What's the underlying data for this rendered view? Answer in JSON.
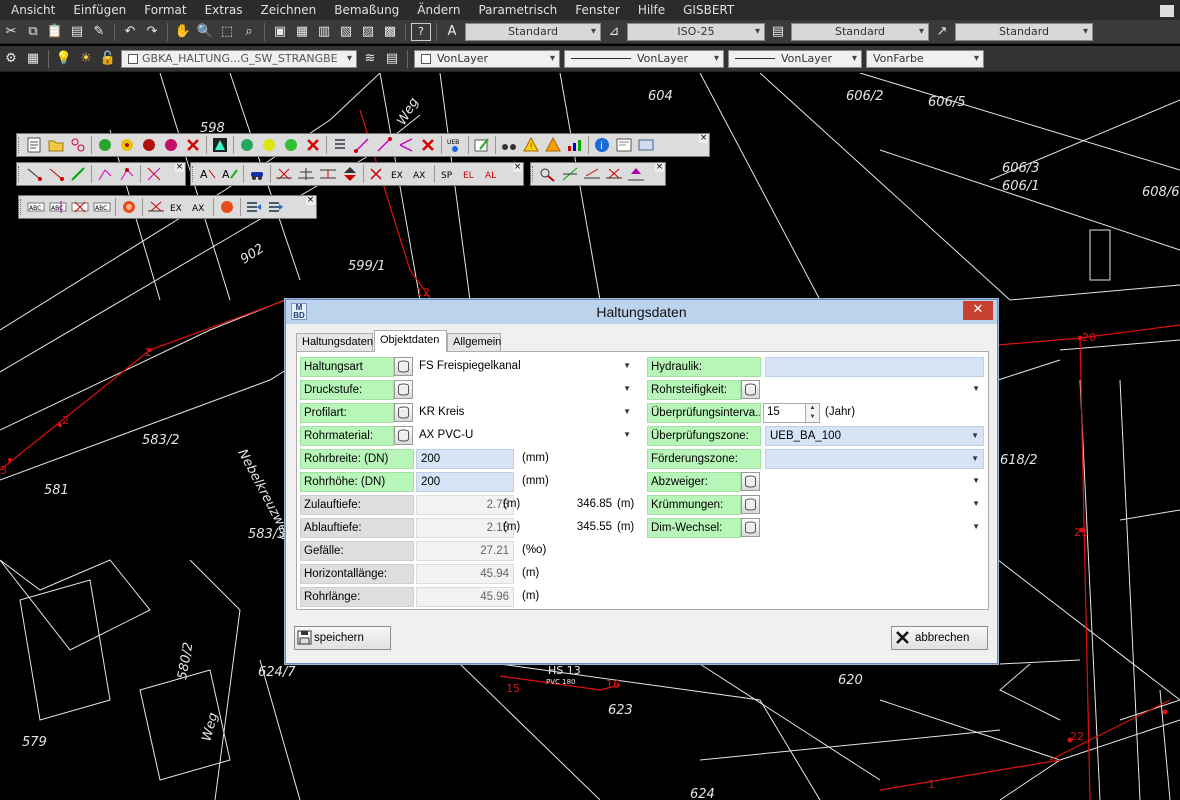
{
  "menu": [
    "Ansicht",
    "Einfügen",
    "Format",
    "Extras",
    "Zeichnen",
    "Bemaßung",
    "Ändern",
    "Parametrisch",
    "Fenster",
    "Hilfe",
    "GISBERT"
  ],
  "toolbar": {
    "text_style": "Standard",
    "dim_style": "ISO-25",
    "table_style": "Standard",
    "multileader_style": "Standard",
    "layer": "GBKA_HALTUNG...G_SW_STRANGBE",
    "color": "VonLayer",
    "linetype": "VonLayer",
    "lineweight": "VonLayer",
    "plotstyle": "VonFarbe"
  },
  "cad": {
    "labels_white": [
      "604",
      "606/2",
      "606/5",
      "606/3",
      "606/1",
      "608/6",
      "598",
      "599/1",
      "583/2",
      "581",
      "583/3",
      "624/7",
      "580/2",
      "579",
      "620",
      "623",
      "618/2",
      "624",
      "902",
      "Weg",
      "Weg",
      "Nebelkreuzweg",
      "HS 13",
      "PVC 180"
    ],
    "labels_red": [
      "12",
      "1",
      "2",
      "3",
      "15",
      "16",
      "20",
      "21",
      "22",
      "1"
    ]
  },
  "dialog": {
    "title": "Haltungsdaten",
    "logo": "M\nBD",
    "tabs": [
      "Haltungsdaten",
      "Objektdaten",
      "Allgemein"
    ],
    "left": {
      "haltungsart": {
        "label": "Haltungsart",
        "value": "FS Freispiegelkanal"
      },
      "druckstufe": {
        "label": "Druckstufe:",
        "value": ""
      },
      "profilart": {
        "label": "Profilart:",
        "value": "KR Kreis"
      },
      "rohrmaterial": {
        "label": "Rohrmaterial:",
        "value": "AX PVC-U"
      },
      "rohrbreite": {
        "label": "Rohrbreite: (DN)",
        "value": "200",
        "unit": "(mm)"
      },
      "rohrhoehe": {
        "label": "Rohrhöhe: (DN)",
        "value": "200",
        "unit": "(mm)"
      },
      "zulauftiefe": {
        "label": "Zulauftiefe:",
        "value": "2.75",
        "unit": "(m)",
        "value2": "346.85",
        "unit2": "(m)"
      },
      "ablauftiefe": {
        "label": "Ablauftiefe:",
        "value": "2.15",
        "unit": "(m)",
        "value2": "345.55",
        "unit2": "(m)"
      },
      "gefaelle": {
        "label": "Gefälle:",
        "value": "27.21",
        "unit": "(%o)"
      },
      "horizontallaenge": {
        "label": "Horizontallänge:",
        "value": "45.94",
        "unit": "(m)"
      },
      "rohrlaenge": {
        "label": "Rohrlänge:",
        "value": "45.96",
        "unit": "(m)"
      }
    },
    "right": {
      "hydraulik": {
        "label": "Hydraulik:",
        "value": ""
      },
      "rohrsteifigkeit": {
        "label": "Rohrsteifigkeit:",
        "value": ""
      },
      "pruefintervall": {
        "label": "Überprüfungsinterva...",
        "value": "15",
        "unit": "(Jahr)"
      },
      "pruefzone": {
        "label": "Überprüfungszone:",
        "value": "UEB_BA_100"
      },
      "foerderzone": {
        "label": "Förderungszone:",
        "value": ""
      },
      "abzweiger": {
        "label": "Abzweiger:",
        "value": ""
      },
      "kruemmungen": {
        "label": "Krümmungen:",
        "value": ""
      },
      "dimwechsel": {
        "label": "Dim-Wechsel:",
        "value": ""
      }
    },
    "save_label": "speichern",
    "cancel_label": "abbrechen"
  }
}
